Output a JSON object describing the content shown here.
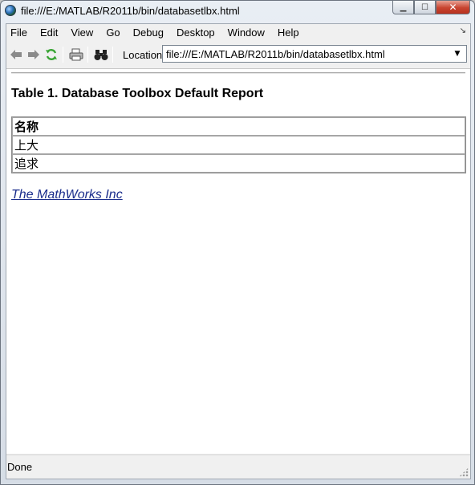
{
  "window": {
    "title": "file:///E:/MATLAB/R2011b/bin/databasetlbx.html",
    "controls": {
      "minimize": "▁",
      "maximize": "☐",
      "close": "✕"
    }
  },
  "menubar": {
    "items": [
      "File",
      "Edit",
      "View",
      "Go",
      "Debug",
      "Desktop",
      "Window",
      "Help"
    ],
    "overflow": "↘"
  },
  "toolbar": {
    "location_label": "Location:",
    "location_value": "file:///E:/MATLAB/R2011b/bin/databasetlbx.html",
    "icons": [
      "back-arrow-icon",
      "forward-arrow-icon",
      "refresh-icon",
      "print-icon",
      "binoculars-find-icon"
    ]
  },
  "page": {
    "title": "Table 1. Database Toolbox Default Report",
    "table": {
      "header": "名称",
      "rows": [
        "上大",
        "追求"
      ]
    },
    "link_text": "The MathWorks Inc"
  },
  "status": {
    "text": "Done"
  },
  "colors": {
    "link": "#1a2d8c",
    "refresh": "#3aa535",
    "close_button": "#c7432f"
  }
}
